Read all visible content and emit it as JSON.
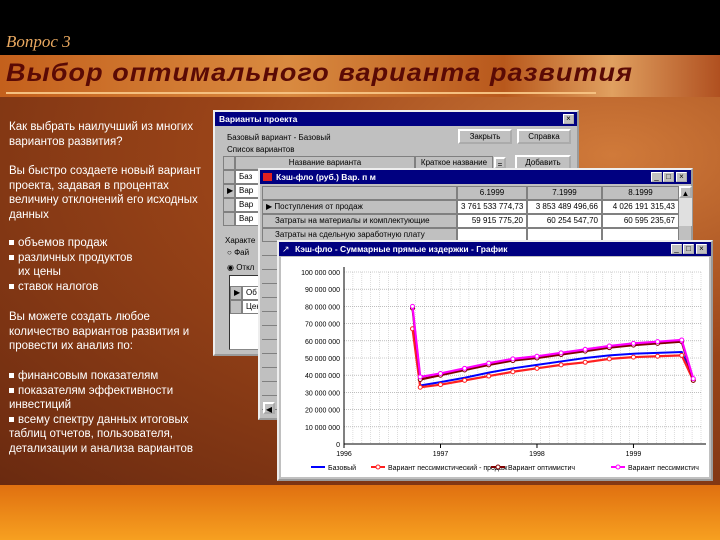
{
  "slide": {
    "question": "Вопрос 3",
    "title": "Выбор оптимального варианта развития",
    "paragraphs": [
      "Как выбрать наилучший из многих вариантов развития?",
      "Вы быстро создаете новый вариант проекта, задавая в процентах величину отклонений его исходных данных"
    ],
    "list1": [
      "объемов продаж",
      "различных продуктов",
      "их цены",
      "ставок налогов"
    ],
    "paragraph3": "Вы можете создать любое количество вариантов развития и провести их анализ по:",
    "list2": [
      "финансовым показателям",
      "показателям эффективности инвестиций",
      "всему спектру данных итоговых таблиц отчетов, пользователя, детализации и анализа вариантов"
    ]
  },
  "variants_window": {
    "title": "Варианты проекта",
    "base_variant": "Базовый вариант - Базовый",
    "close": "Закрыть",
    "help": "Справка",
    "list_label": "Список вариантов",
    "col_name": "Название варианта",
    "col_short": "Краткое название",
    "add": "Добавить",
    "rows": [
      "Баз",
      "Вар",
      "Вар",
      "Вар"
    ],
    "char_label": "Характе",
    "radio1": "Фай",
    "radio2": "Откл",
    "sub_rows": [
      "Об",
      "Цен"
    ]
  },
  "cashflow_window": {
    "title": "Кэш-фло (руб.)  Вар. п м",
    "columns": [
      "6.1999",
      "7.1999",
      "8.1999"
    ],
    "rows": [
      {
        "label": "Поступления от продаж",
        "values": [
          "3 761 533 774,73",
          "3 853 489 496,66",
          "4 026 191 315,43"
        ]
      },
      {
        "label": "Затраты на материалы и комплектующие",
        "values": [
          "59 915 775,20",
          "60 254 547,70",
          "60 595 235,67"
        ]
      },
      {
        "label": "Затраты на сдельную заработную плату",
        "values": [
          "",
          "",
          ""
        ]
      }
    ]
  },
  "chart_window": {
    "title": "Кэш-фло - Суммарные прямые издержки - График"
  },
  "chart_data": {
    "type": "line",
    "xlim": [
      1996,
      1999.7
    ],
    "ylim": [
      0,
      100000000
    ],
    "grid": true,
    "legend": "bottom",
    "x_ticks": [
      "1996",
      "1997",
      "1998",
      "1999"
    ],
    "y_ticks": [
      "0",
      "10 000 000",
      "20 000 000",
      "30 000 000",
      "40 000 000",
      "50 000 000",
      "60 000 000",
      "70 000 000",
      "80 000 000",
      "90 000 000",
      "100 000 000"
    ],
    "x": [
      1996.71,
      1996.79,
      1997.0,
      1997.25,
      1997.5,
      1997.75,
      1998.0,
      1998.25,
      1998.5,
      1998.75,
      1999.0,
      1999.25,
      1999.5,
      1999.62
    ],
    "series": [
      {
        "name": "Базовый",
        "color": "#0000ff",
        "marker": false,
        "values": [
          68000000,
          34000000,
          36000000,
          38500000,
          41500000,
          44000000,
          46000000,
          48000000,
          50000000,
          51500000,
          52500000,
          53000000,
          53500000,
          38000000
        ]
      },
      {
        "name": "Вариант пессимистический - продаж",
        "color": "#ff2020",
        "marker": true,
        "values": [
          67000000,
          33000000,
          34500000,
          37000000,
          39500000,
          42000000,
          44000000,
          46000000,
          47500000,
          49500000,
          50500000,
          51000000,
          51500000,
          37000000
        ]
      },
      {
        "name": "Вариант оптимистич",
        "color": "#800000",
        "marker": true,
        "values": [
          79000000,
          37500000,
          40000000,
          43000000,
          46000000,
          48500000,
          50000000,
          52000000,
          54000000,
          56000000,
          57500000,
          58500000,
          59500000,
          37000000
        ]
      },
      {
        "name": "Вариант пессимистич",
        "color": "#ff00ff",
        "marker": true,
        "values": [
          80000000,
          39000000,
          41000000,
          44000000,
          47000000,
          49500000,
          51000000,
          53000000,
          55000000,
          57000000,
          58500000,
          59500000,
          60500000,
          38000000
        ]
      }
    ]
  }
}
